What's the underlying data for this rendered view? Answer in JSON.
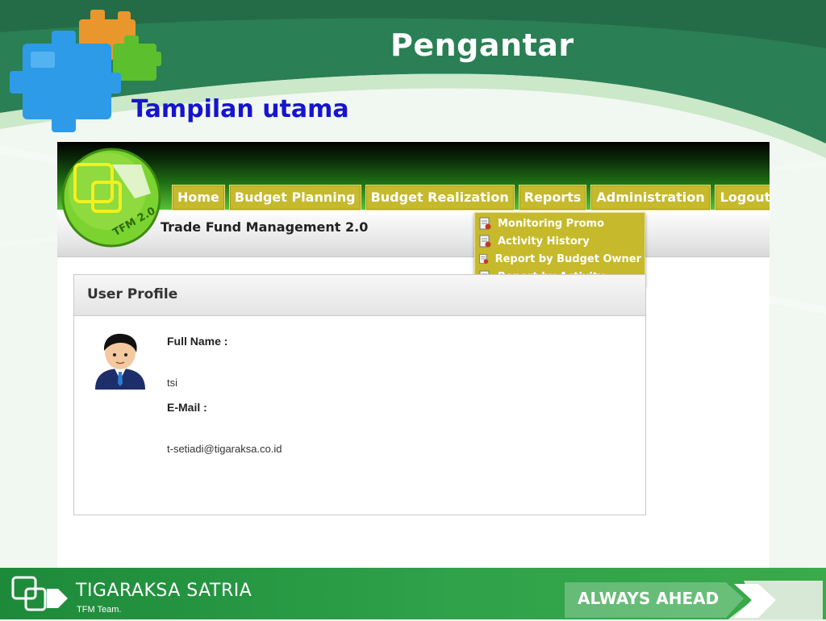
{
  "slide": {
    "title": "Pengantar",
    "subtitle": "Tampilan utama"
  },
  "app": {
    "title": "Trade Fund Management 2.0",
    "logo_text": "TFM 2.0",
    "nav": [
      {
        "label": "Home"
      },
      {
        "label": "Budget Planning"
      },
      {
        "label": "Budget Realization"
      },
      {
        "label": "Reports"
      },
      {
        "label": "Administration"
      },
      {
        "label": "Logout"
      }
    ],
    "reports_menu": [
      {
        "label": "Monitoring Promo",
        "icon": "report-document-icon"
      },
      {
        "label": "Activity History",
        "icon": "report-document-icon"
      },
      {
        "label": "Report by Budget Owner",
        "icon": "report-document-icon"
      },
      {
        "label": "Report by Activity",
        "icon": "report-document-icon"
      }
    ],
    "profile": {
      "heading": "User Profile",
      "full_name_label": "Full Name :",
      "full_name_value": "tsi",
      "email_label": "E-Mail :",
      "email_value": "t-setiadi@tigaraksa.co.id",
      "avatar_icon": "user-avatar-icon"
    }
  },
  "footer": {
    "company": "TIGARAKSA SATRIA",
    "team": "TFM Team.",
    "slogan": "ALWAYS AHEAD"
  },
  "colors": {
    "nav_bg": "#c6b92b",
    "subtitle": "#1515cc",
    "header_green": "#2a7f54",
    "footer_green": "#2fa24a"
  }
}
